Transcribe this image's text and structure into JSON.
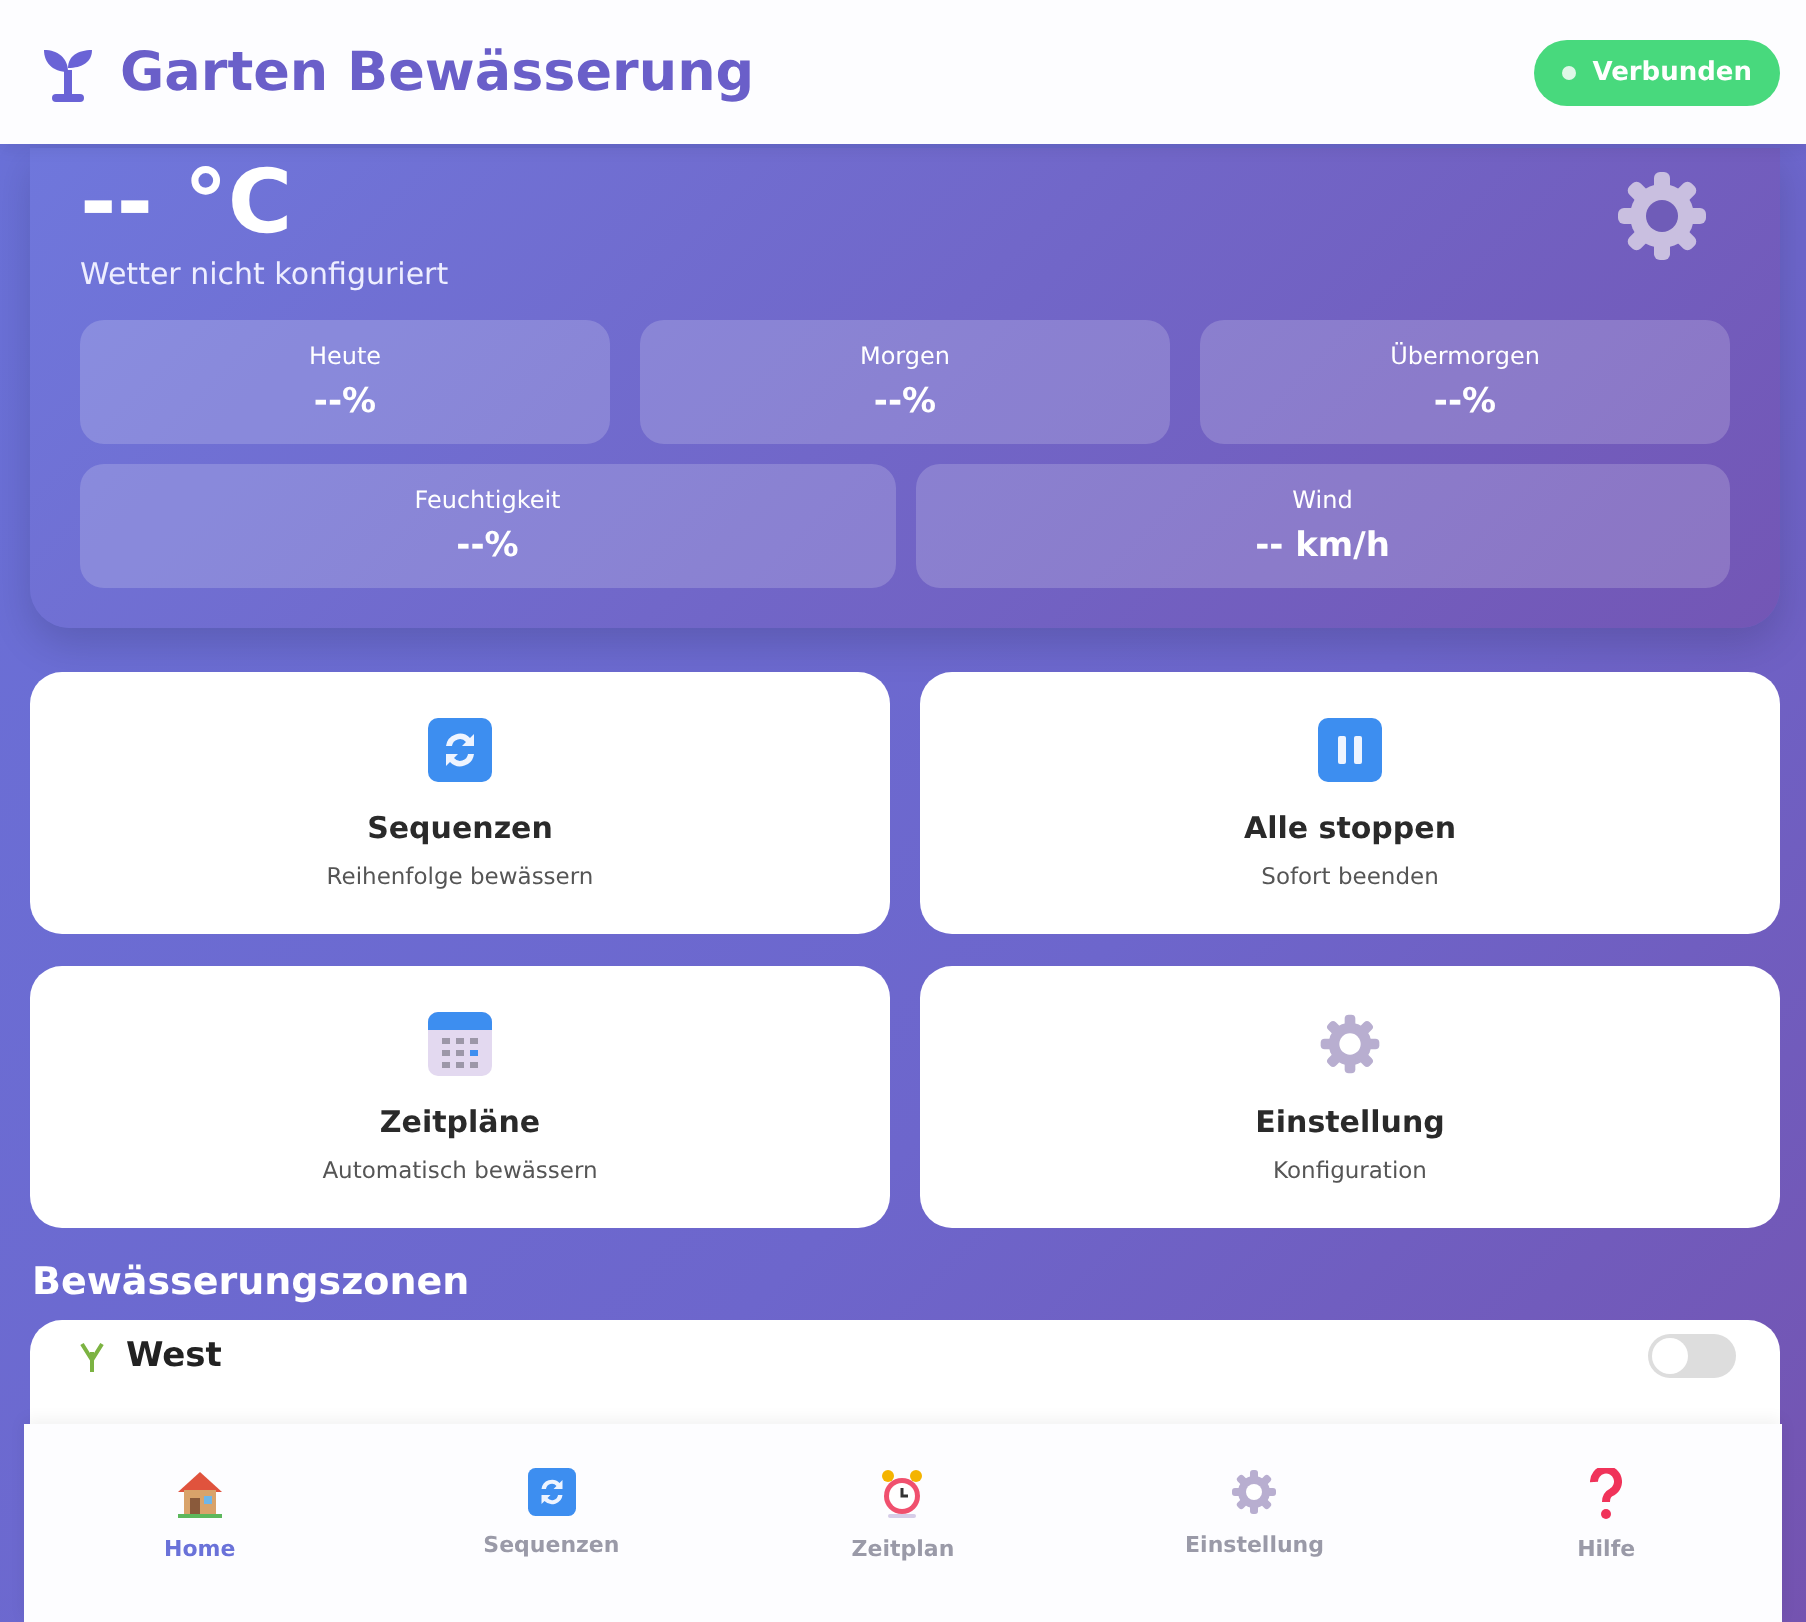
{
  "header": {
    "title": "Garten Bewässerung",
    "status": {
      "label": "Verbunden",
      "connected": true
    }
  },
  "weather": {
    "temperature": "-- °C",
    "description": "Wetter nicht konfiguriert",
    "forecast": [
      {
        "label": "Heute",
        "value": "--%"
      },
      {
        "label": "Morgen",
        "value": "--%"
      },
      {
        "label": "Übermorgen",
        "value": "--%"
      }
    ],
    "details": [
      {
        "label": "Feuchtigkeit",
        "value": "--%"
      },
      {
        "label": "Wind",
        "value": "-- km/h"
      }
    ]
  },
  "actions": [
    {
      "kind": "sequence",
      "title": "Sequenzen",
      "subtitle": "Reihenfolge bewässern"
    },
    {
      "kind": "stop",
      "title": "Alle stoppen",
      "subtitle": "Sofort beenden"
    },
    {
      "kind": "schedule",
      "title": "Zeitpläne",
      "subtitle": "Automatisch bewässern"
    },
    {
      "kind": "settings",
      "title": "Einstellung",
      "subtitle": "Konfiguration"
    }
  ],
  "zones": {
    "title": "Bewässerungszonen",
    "items": [
      {
        "name": "West",
        "on": false
      }
    ]
  },
  "bottom_nav": [
    {
      "kind": "home",
      "label": "Home",
      "selected": true
    },
    {
      "kind": "sequence",
      "label": "Sequenzen",
      "selected": false
    },
    {
      "kind": "alarm",
      "label": "Zeitplan",
      "selected": false
    },
    {
      "kind": "settings",
      "label": "Einstellung",
      "selected": false
    },
    {
      "kind": "help",
      "label": "Hilfe",
      "selected": false
    }
  ]
}
